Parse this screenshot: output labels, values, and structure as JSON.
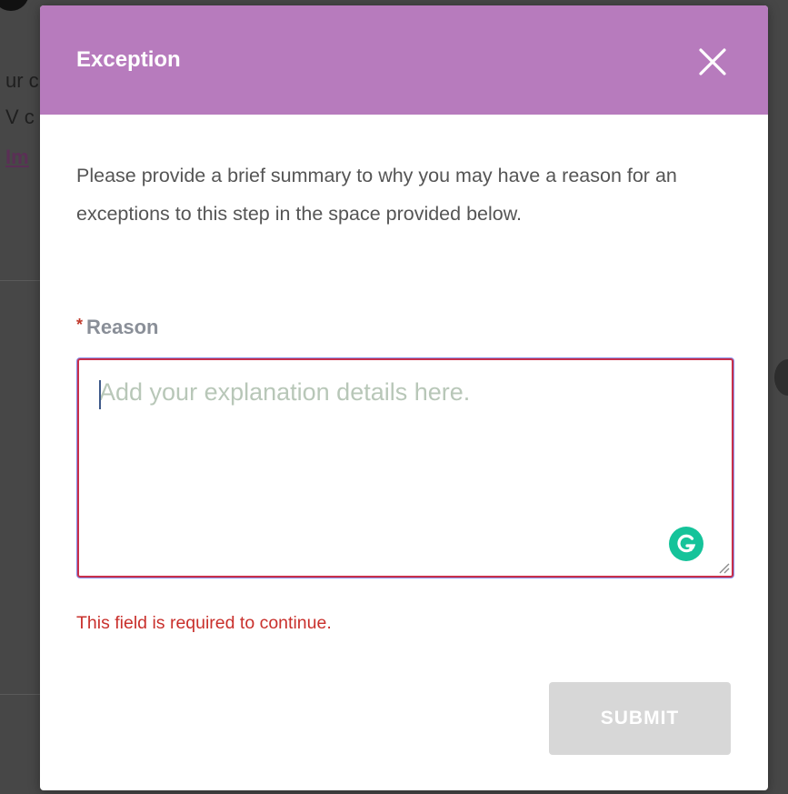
{
  "background": {
    "text_line_1": "ur c",
    "text_line_2": "V c",
    "link_text": "Im"
  },
  "modal": {
    "title": "Exception",
    "close_icon": "close-icon",
    "description": "Please provide a brief summary to why you may have a reason for an exceptions to this step in the space provided below.",
    "field": {
      "required_marker": "*",
      "label": "Reason",
      "placeholder": "Add your explanation details here.",
      "value": ""
    },
    "error_message": "This field is required to continue.",
    "submit_label": "SUBMIT",
    "submit_disabled": true
  },
  "colors": {
    "header": "#b77bbd",
    "error": "#c9302c",
    "submit_disabled": "#d7d7d7",
    "grammarly": "#15c39a"
  }
}
